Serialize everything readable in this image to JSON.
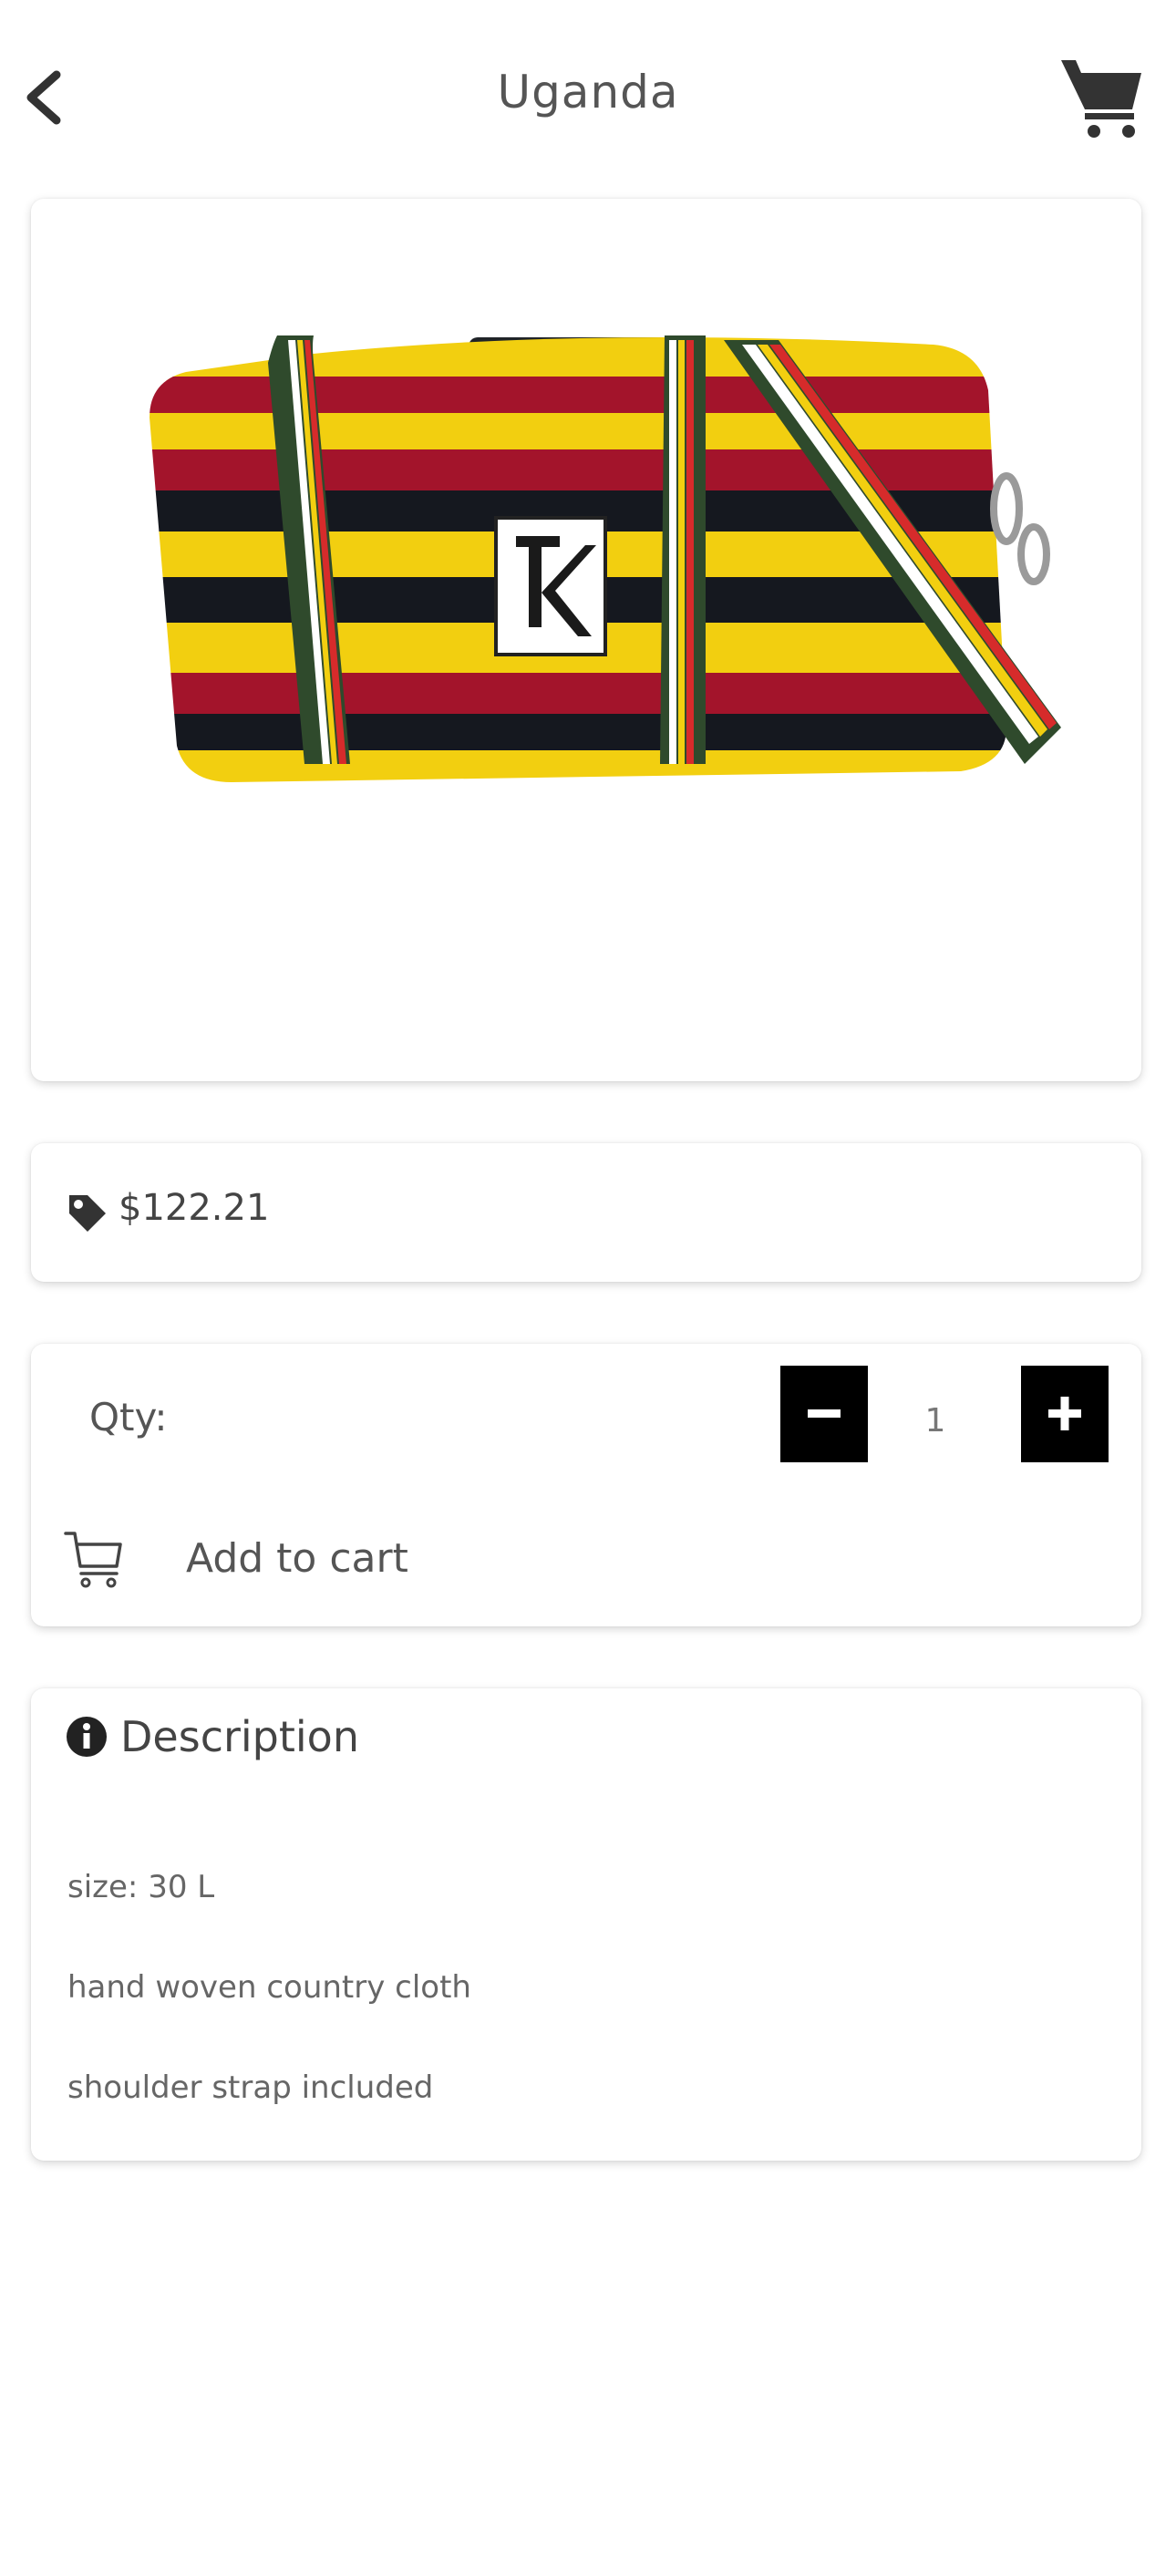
{
  "header": {
    "title": "Uganda",
    "back_icon": "chevron-left-icon",
    "cart_icon": "shopping-cart-icon"
  },
  "product": {
    "image_alt": "Striped woven duffel bag with shoulder strap",
    "price": "$122.21",
    "price_icon": "tag-icon"
  },
  "purchase": {
    "qty_label": "Qty:",
    "qty_value": "1",
    "minus_icon": "minus-icon",
    "plus_icon": "plus-icon",
    "add_to_cart_label": "Add to cart",
    "add_to_cart_icon": "cart-outline-icon"
  },
  "description": {
    "title": "Description",
    "icon": "info-icon",
    "lines": [
      "size: 30 L",
      "hand woven country cloth",
      "shoulder strap included"
    ]
  },
  "colors": {
    "stripe_yellow": "#f2cf10",
    "stripe_red": "#a3142b",
    "stripe_black": "#15181f",
    "strap_green": "#2f4a2c",
    "button_black": "#000000"
  }
}
